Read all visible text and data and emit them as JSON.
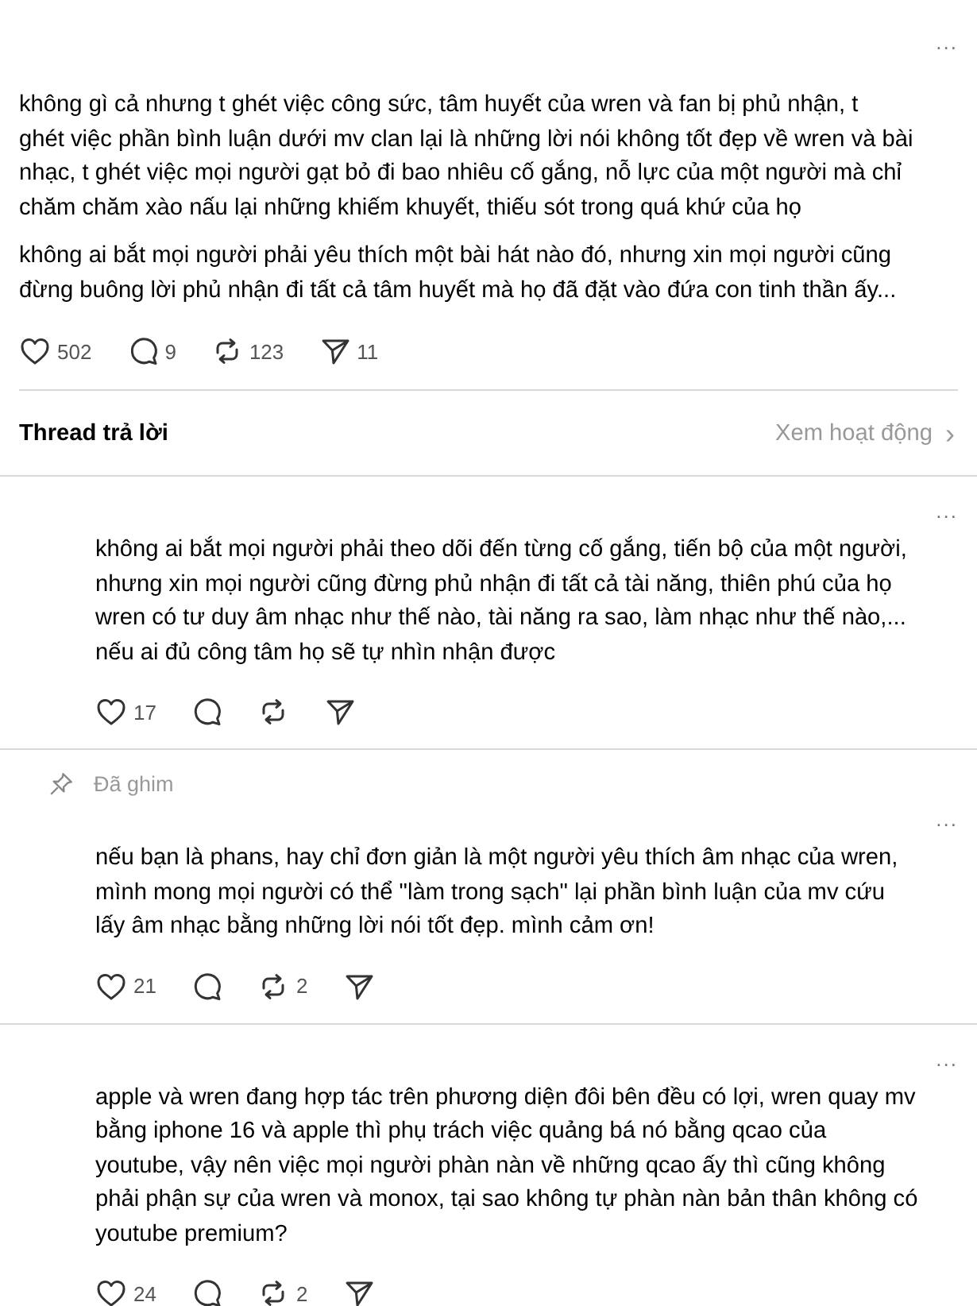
{
  "post": {
    "more": "...",
    "paragraphs": [
      "không gì cả nhưng t ghét việc công sức, tâm huyết của wren và fan bị phủ nhận, t\nghét việc phần bình luận dưới mv clan lại là những lời nói không tốt đẹp về wren và bài\nnhạc, t ghét việc mọi người gạt bỏ đi bao nhiêu cố gắng, nỗ lực của một người mà chỉ\nchăm chăm xào nấu lại những khiếm khuyết, thiếu sót trong quá khứ của họ",
      "không ai bắt mọi người phải yêu thích một bài hát nào đó, nhưng xin mọi người cũng\nđừng buông lời phủ nhận đi tất cả tâm huyết mà họ đã đặt vào đứa con tinh thần ấy..."
    ],
    "actions": [
      {
        "kind": "like",
        "count": "502"
      },
      {
        "kind": "comment",
        "count": "9"
      },
      {
        "kind": "repost",
        "count": "123"
      },
      {
        "kind": "share",
        "count": "11"
      }
    ]
  },
  "replies_header": {
    "title": "Thread trả lời",
    "link": "Xem hoạt động",
    "chevron": "›"
  },
  "replies": [
    {
      "pinned": false,
      "more": "...",
      "text": "không ai bắt mọi người phải theo dõi đến từng cố gắng, tiến bộ của một người,\nnhưng xin mọi người cũng đừng phủ nhận đi tất cả tài năng, thiên phú của họ\nwren có tư duy âm nhạc như thế nào, tài năng ra sao, làm nhạc như thế nào,...\nnếu ai đủ công tâm họ sẽ tự nhìn nhận được",
      "actions": [
        {
          "kind": "like",
          "count": "17"
        },
        {
          "kind": "comment"
        },
        {
          "kind": "repost"
        },
        {
          "kind": "share"
        }
      ]
    },
    {
      "pinned": true,
      "pin_label": "Đã ghim",
      "more": "...",
      "text": "nếu bạn là phans, hay chỉ đơn giản là một người yêu thích âm nhạc của wren,\nmình mong mọi người có thể \"làm trong sạch\" lại phần bình luận của mv cứu\nlấy âm nhạc bằng những lời nói tốt đẹp. mình cảm ơn!",
      "actions": [
        {
          "kind": "like",
          "count": "21"
        },
        {
          "kind": "comment"
        },
        {
          "kind": "repost",
          "count": "2"
        },
        {
          "kind": "share"
        }
      ]
    },
    {
      "pinned": false,
      "more": "...",
      "text": "apple và wren đang hợp tác trên phương diện đôi bên đều có lợi, wren quay mv\nbằng iphone 16 và apple thì phụ trách việc quảng bá nó bằng qcao của\nyoutube, vậy nên việc mọi người phàn nàn về những qcao ấy thì cũng không\nphải phận sự của wren và monox, tại sao không tự phàn nàn bản thân không có\nyoutube premium?",
      "actions": [
        {
          "kind": "like",
          "count": "24"
        },
        {
          "kind": "comment"
        },
        {
          "kind": "repost",
          "count": "2"
        },
        {
          "kind": "share"
        }
      ]
    }
  ]
}
